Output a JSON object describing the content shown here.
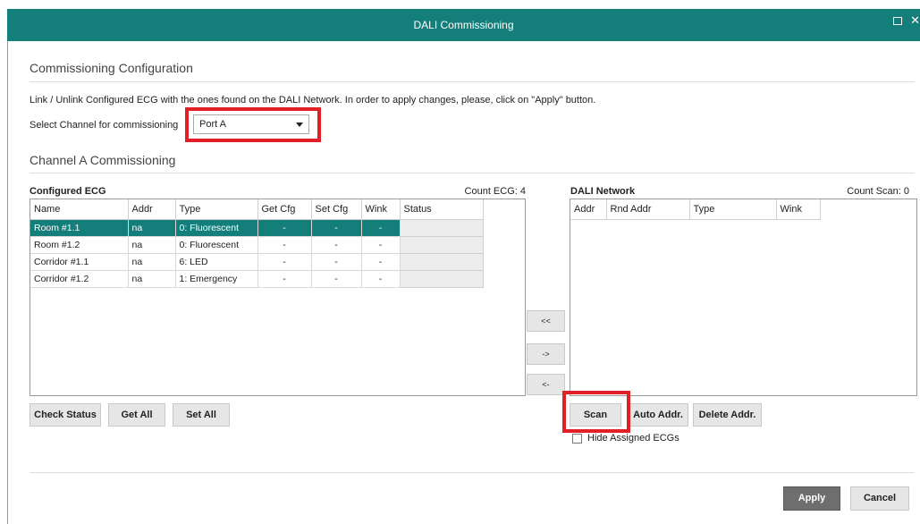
{
  "window": {
    "title": "DALI Commissioning",
    "maximize_glyph": "□",
    "close_glyph": "✕"
  },
  "config": {
    "heading": "Commissioning Configuration",
    "description": "Link / Unlink Configured ECG with the ones found on the DALI Network. In order to apply changes, please, click on \"Apply\" button.",
    "channel_label": "Select Channel for commissioning",
    "channel_value": "Port A"
  },
  "channel": {
    "heading": "Channel A Commissioning"
  },
  "configured": {
    "label": "Configured ECG",
    "count_label": "Count ECG: 4",
    "columns": [
      "Name",
      "Addr",
      "Type",
      "Get Cfg",
      "Set Cfg",
      "Wink",
      "Status"
    ],
    "rows": [
      {
        "name": "Room #1.1",
        "addr": "na",
        "type": "0: Fluorescent",
        "get": "-",
        "set": "-",
        "wink": "-",
        "status": "",
        "selected": true
      },
      {
        "name": "Room #1.2",
        "addr": "na",
        "type": "0: Fluorescent",
        "get": "-",
        "set": "-",
        "wink": "-",
        "status": ""
      },
      {
        "name": "Corridor #1.1",
        "addr": "na",
        "type": "6: LED",
        "get": "-",
        "set": "-",
        "wink": "-",
        "status": ""
      },
      {
        "name": "Corridor #1.2",
        "addr": "na",
        "type": "1: Emergency",
        "get": "-",
        "set": "-",
        "wink": "-",
        "status": ""
      }
    ]
  },
  "network": {
    "label": "DALI Network",
    "count_label": "Count Scan: 0",
    "columns": [
      "Addr",
      "Rnd Addr",
      "Type",
      "Wink"
    ]
  },
  "transfer": {
    "unlink_all": "<<",
    "link": "->",
    "unlink": "<-"
  },
  "buttons": {
    "check_status": "Check Status",
    "get_all": "Get All",
    "set_all": "Set All",
    "scan": "Scan",
    "auto_addr": "Auto Addr.",
    "delete_addr": "Delete Addr.",
    "apply": "Apply",
    "cancel": "Cancel"
  },
  "hide_assigned": {
    "label": "Hide Assigned ECGs",
    "checked": false
  },
  "colors": {
    "accent": "#137e7a",
    "highlight": "#e21f26",
    "apply_bg": "#6e6e6e"
  }
}
